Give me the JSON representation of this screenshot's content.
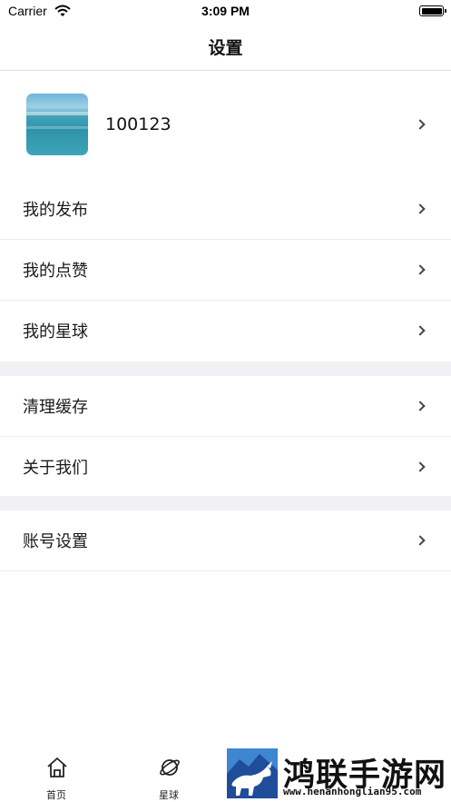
{
  "status_bar": {
    "carrier": "Carrier",
    "time": "3:09 PM"
  },
  "nav": {
    "title": "设置"
  },
  "profile": {
    "username": "100123"
  },
  "menu_groups": [
    [
      "我的发布",
      "我的点赞",
      "我的星球"
    ],
    [
      "清理缓存",
      "关于我们"
    ],
    [
      "账号设置"
    ]
  ],
  "tabs": [
    {
      "label": "首页",
      "icon": "home-icon"
    },
    {
      "label": "星球",
      "icon": "planet-icon"
    }
  ],
  "watermark": {
    "title": "鸿联手游网",
    "url": "www.henanhonglian95.com",
    "logo": "bull-logo"
  },
  "colors": {
    "separator": "#ebebeb",
    "section_gap": "#f1f1f5",
    "logo_blue": "#1f4d99"
  }
}
